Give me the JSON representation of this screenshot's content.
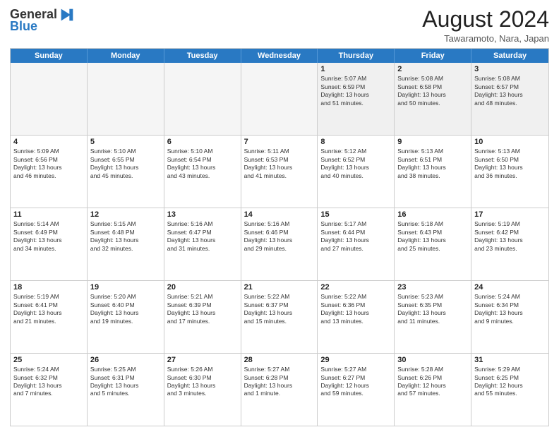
{
  "logo": {
    "general": "General",
    "blue": "Blue"
  },
  "title": {
    "month_year": "August 2024",
    "location": "Tawaramoto, Nara, Japan"
  },
  "weekdays": [
    "Sunday",
    "Monday",
    "Tuesday",
    "Wednesday",
    "Thursday",
    "Friday",
    "Saturday"
  ],
  "weeks": [
    [
      {
        "day": "",
        "empty": true,
        "info": ""
      },
      {
        "day": "",
        "empty": true,
        "info": ""
      },
      {
        "day": "",
        "empty": true,
        "info": ""
      },
      {
        "day": "",
        "empty": true,
        "info": ""
      },
      {
        "day": "1",
        "empty": false,
        "info": "Sunrise: 5:07 AM\nSunset: 6:59 PM\nDaylight: 13 hours\nand 51 minutes."
      },
      {
        "day": "2",
        "empty": false,
        "info": "Sunrise: 5:08 AM\nSunset: 6:58 PM\nDaylight: 13 hours\nand 50 minutes."
      },
      {
        "day": "3",
        "empty": false,
        "info": "Sunrise: 5:08 AM\nSunset: 6:57 PM\nDaylight: 13 hours\nand 48 minutes."
      }
    ],
    [
      {
        "day": "4",
        "empty": false,
        "info": "Sunrise: 5:09 AM\nSunset: 6:56 PM\nDaylight: 13 hours\nand 46 minutes."
      },
      {
        "day": "5",
        "empty": false,
        "info": "Sunrise: 5:10 AM\nSunset: 6:55 PM\nDaylight: 13 hours\nand 45 minutes."
      },
      {
        "day": "6",
        "empty": false,
        "info": "Sunrise: 5:10 AM\nSunset: 6:54 PM\nDaylight: 13 hours\nand 43 minutes."
      },
      {
        "day": "7",
        "empty": false,
        "info": "Sunrise: 5:11 AM\nSunset: 6:53 PM\nDaylight: 13 hours\nand 41 minutes."
      },
      {
        "day": "8",
        "empty": false,
        "info": "Sunrise: 5:12 AM\nSunset: 6:52 PM\nDaylight: 13 hours\nand 40 minutes."
      },
      {
        "day": "9",
        "empty": false,
        "info": "Sunrise: 5:13 AM\nSunset: 6:51 PM\nDaylight: 13 hours\nand 38 minutes."
      },
      {
        "day": "10",
        "empty": false,
        "info": "Sunrise: 5:13 AM\nSunset: 6:50 PM\nDaylight: 13 hours\nand 36 minutes."
      }
    ],
    [
      {
        "day": "11",
        "empty": false,
        "info": "Sunrise: 5:14 AM\nSunset: 6:49 PM\nDaylight: 13 hours\nand 34 minutes."
      },
      {
        "day": "12",
        "empty": false,
        "info": "Sunrise: 5:15 AM\nSunset: 6:48 PM\nDaylight: 13 hours\nand 32 minutes."
      },
      {
        "day": "13",
        "empty": false,
        "info": "Sunrise: 5:16 AM\nSunset: 6:47 PM\nDaylight: 13 hours\nand 31 minutes."
      },
      {
        "day": "14",
        "empty": false,
        "info": "Sunrise: 5:16 AM\nSunset: 6:46 PM\nDaylight: 13 hours\nand 29 minutes."
      },
      {
        "day": "15",
        "empty": false,
        "info": "Sunrise: 5:17 AM\nSunset: 6:44 PM\nDaylight: 13 hours\nand 27 minutes."
      },
      {
        "day": "16",
        "empty": false,
        "info": "Sunrise: 5:18 AM\nSunset: 6:43 PM\nDaylight: 13 hours\nand 25 minutes."
      },
      {
        "day": "17",
        "empty": false,
        "info": "Sunrise: 5:19 AM\nSunset: 6:42 PM\nDaylight: 13 hours\nand 23 minutes."
      }
    ],
    [
      {
        "day": "18",
        "empty": false,
        "info": "Sunrise: 5:19 AM\nSunset: 6:41 PM\nDaylight: 13 hours\nand 21 minutes."
      },
      {
        "day": "19",
        "empty": false,
        "info": "Sunrise: 5:20 AM\nSunset: 6:40 PM\nDaylight: 13 hours\nand 19 minutes."
      },
      {
        "day": "20",
        "empty": false,
        "info": "Sunrise: 5:21 AM\nSunset: 6:39 PM\nDaylight: 13 hours\nand 17 minutes."
      },
      {
        "day": "21",
        "empty": false,
        "info": "Sunrise: 5:22 AM\nSunset: 6:37 PM\nDaylight: 13 hours\nand 15 minutes."
      },
      {
        "day": "22",
        "empty": false,
        "info": "Sunrise: 5:22 AM\nSunset: 6:36 PM\nDaylight: 13 hours\nand 13 minutes."
      },
      {
        "day": "23",
        "empty": false,
        "info": "Sunrise: 5:23 AM\nSunset: 6:35 PM\nDaylight: 13 hours\nand 11 minutes."
      },
      {
        "day": "24",
        "empty": false,
        "info": "Sunrise: 5:24 AM\nSunset: 6:34 PM\nDaylight: 13 hours\nand 9 minutes."
      }
    ],
    [
      {
        "day": "25",
        "empty": false,
        "info": "Sunrise: 5:24 AM\nSunset: 6:32 PM\nDaylight: 13 hours\nand 7 minutes."
      },
      {
        "day": "26",
        "empty": false,
        "info": "Sunrise: 5:25 AM\nSunset: 6:31 PM\nDaylight: 13 hours\nand 5 minutes."
      },
      {
        "day": "27",
        "empty": false,
        "info": "Sunrise: 5:26 AM\nSunset: 6:30 PM\nDaylight: 13 hours\nand 3 minutes."
      },
      {
        "day": "28",
        "empty": false,
        "info": "Sunrise: 5:27 AM\nSunset: 6:28 PM\nDaylight: 13 hours\nand 1 minute."
      },
      {
        "day": "29",
        "empty": false,
        "info": "Sunrise: 5:27 AM\nSunset: 6:27 PM\nDaylight: 12 hours\nand 59 minutes."
      },
      {
        "day": "30",
        "empty": false,
        "info": "Sunrise: 5:28 AM\nSunset: 6:26 PM\nDaylight: 12 hours\nand 57 minutes."
      },
      {
        "day": "31",
        "empty": false,
        "info": "Sunrise: 5:29 AM\nSunset: 6:25 PM\nDaylight: 12 hours\nand 55 minutes."
      }
    ]
  ]
}
